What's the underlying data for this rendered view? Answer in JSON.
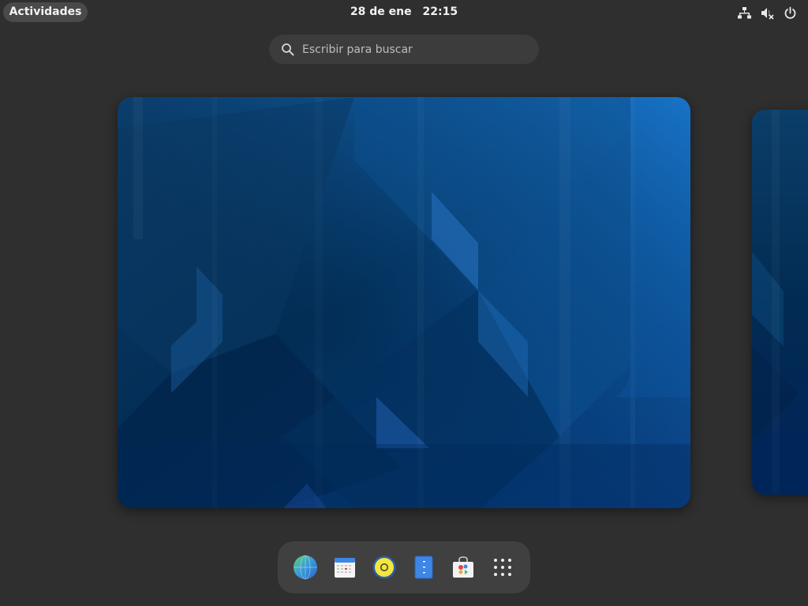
{
  "topbar": {
    "activities_label": "Actividades",
    "date": "28 de ene",
    "time": "22:15",
    "tray_icons": [
      "network-wired-icon",
      "audio-volume-muted-icon",
      "power-icon"
    ]
  },
  "search": {
    "placeholder": "Escribir para buscar",
    "value": ""
  },
  "workspaces": {
    "current_wallpaper": "blue-geometric",
    "colors": {
      "wallpaper_dark": "#002a52",
      "wallpaper_mid": "#0a4a85",
      "wallpaper_light": "#1a7fd4"
    }
  },
  "dash": {
    "apps": [
      {
        "icon": "browser-globe-icon"
      },
      {
        "icon": "calendar-icon"
      },
      {
        "icon": "music-player-icon"
      },
      {
        "icon": "text-editor-icon"
      },
      {
        "icon": "software-store-icon"
      },
      {
        "icon": "show-apps-grid-icon"
      }
    ]
  },
  "colors": {
    "background": "#2f2f2f",
    "panel_button": "#4a4a4a",
    "dash_background": "#404040",
    "search_background": "#3c3c3c"
  }
}
